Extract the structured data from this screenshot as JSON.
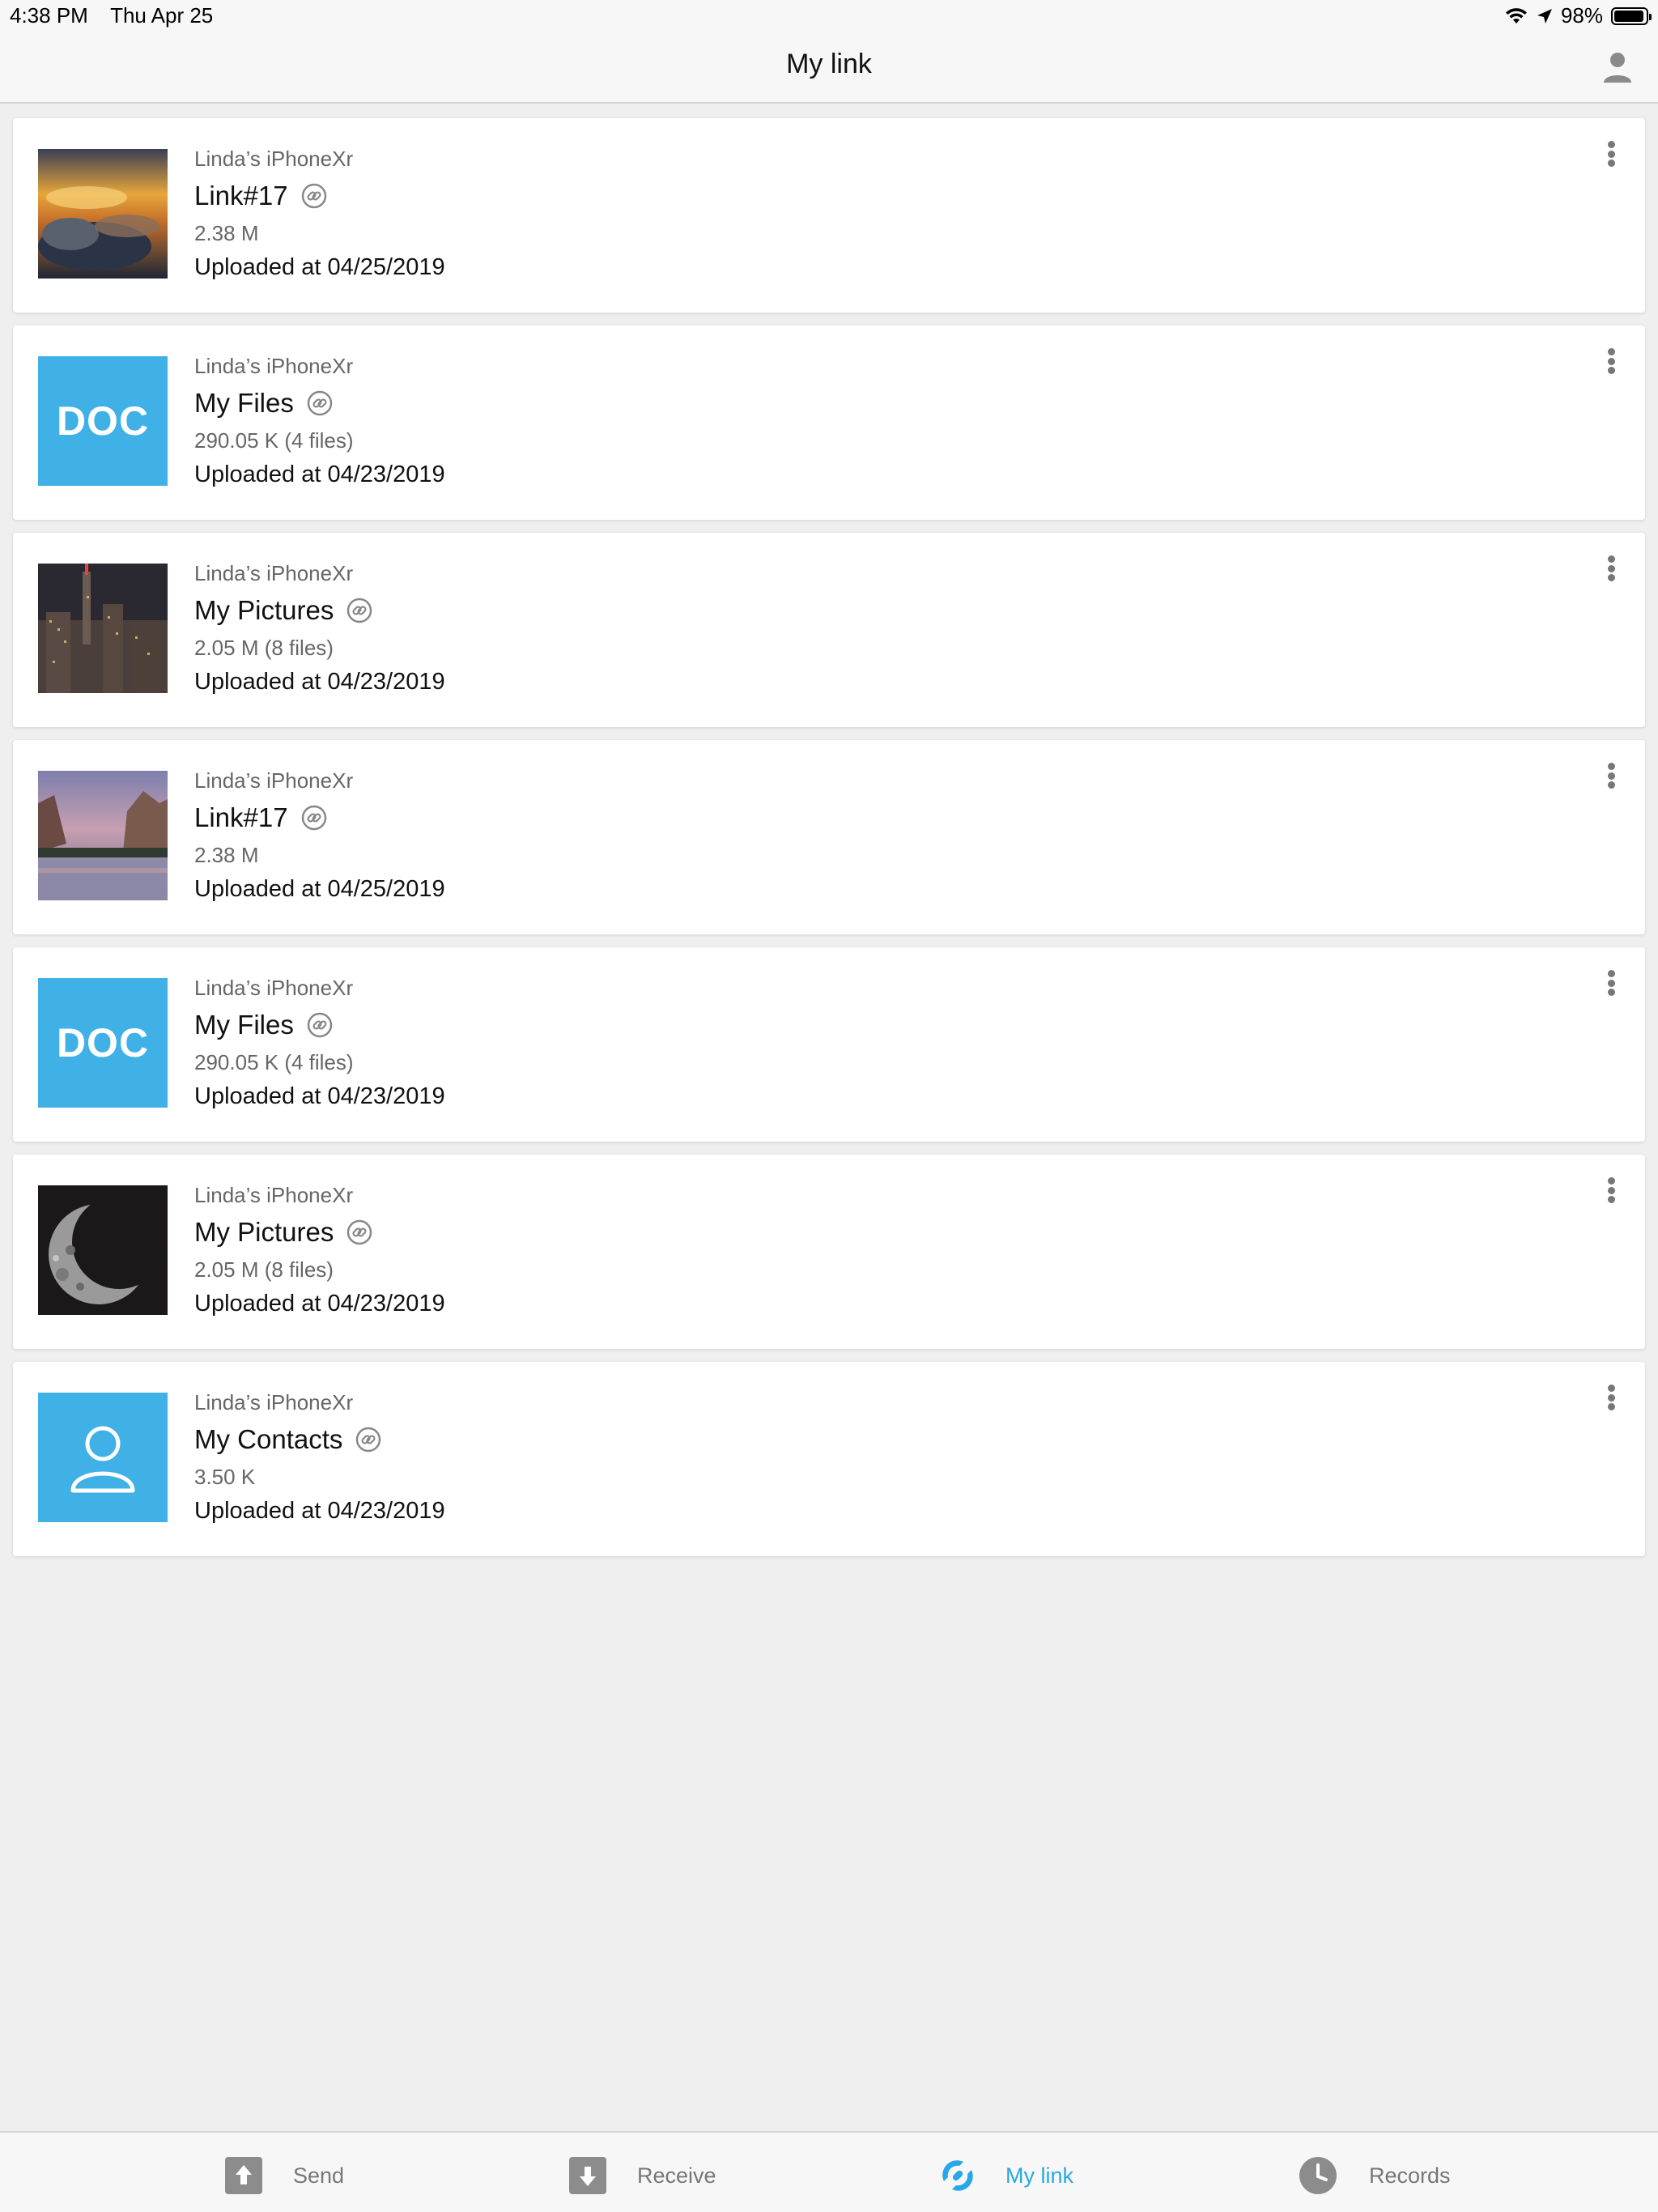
{
  "status_bar": {
    "time": "4:38 PM",
    "date": "Thu Apr 25",
    "battery": "98%",
    "battery_level": 0.98
  },
  "nav": {
    "title": "My link",
    "profile_icon": "person-icon"
  },
  "items": [
    {
      "device": "Linda’s iPhoneXr",
      "title": "Link#17",
      "size": "2.38 M",
      "uploaded": "Uploaded at 04/25/2019",
      "thumb": "sunset-clouds-photo"
    },
    {
      "device": "Linda’s iPhoneXr",
      "title": "My Files",
      "size": "290.05 K (4 files)",
      "uploaded": "Uploaded at 04/23/2019",
      "thumb": "doc",
      "thumb_label": "DOC"
    },
    {
      "device": "Linda’s iPhoneXr",
      "title": "My Pictures",
      "size": "2.05 M (8 files)",
      "uploaded": "Uploaded at 04/23/2019",
      "thumb": "city-night-photo"
    },
    {
      "device": "Linda’s iPhoneXr",
      "title": "Link#17",
      "size": "2.38 M",
      "uploaded": "Uploaded at 04/25/2019",
      "thumb": "mountain-lake-photo"
    },
    {
      "device": "Linda’s iPhoneXr",
      "title": "My Files",
      "size": "290.05 K (4 files)",
      "uploaded": "Uploaded at 04/23/2019",
      "thumb": "doc",
      "thumb_label": "DOC"
    },
    {
      "device": "Linda’s iPhoneXr",
      "title": "My Pictures",
      "size": "2.05 M (8 files)",
      "uploaded": "Uploaded at 04/23/2019",
      "thumb": "moon-photo"
    },
    {
      "device": "Linda’s iPhoneXr",
      "title": "My Contacts",
      "size": "3.50 K",
      "uploaded": "Uploaded at 04/23/2019",
      "thumb": "contact"
    }
  ],
  "tabs": [
    {
      "label": "Send",
      "icon": "upload-arrow-icon",
      "active": false
    },
    {
      "label": "Receive",
      "icon": "download-arrow-icon",
      "active": false
    },
    {
      "label": "My link",
      "icon": "link-icon",
      "active": true
    },
    {
      "label": "Records",
      "icon": "clock-icon",
      "active": false
    }
  ],
  "colors": {
    "accent": "#2aa7e6",
    "doc_tile": "#3fb1e7",
    "background": "#efefef"
  }
}
